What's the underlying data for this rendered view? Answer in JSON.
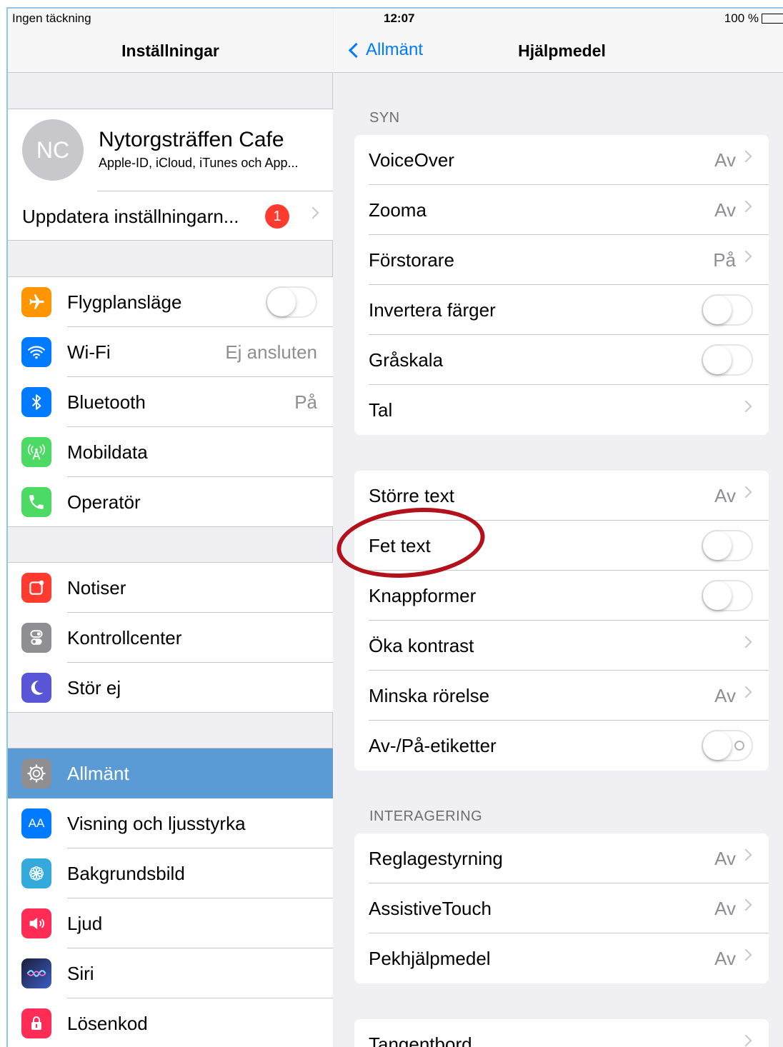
{
  "status": {
    "carrier": "Ingen täckning",
    "time": "12:07",
    "battery": "100 %"
  },
  "left": {
    "title": "Inställningar",
    "profile": {
      "initials": "NC",
      "name": "Nytorgsträffen Cafe",
      "subtitle": "Apple-ID, iCloud, iTunes och App..."
    },
    "update": {
      "label": "Uppdatera inställningarn...",
      "badge": "1"
    },
    "items": [
      {
        "label": "Flygplansläge",
        "value": "",
        "icon": "airplane-icon",
        "color": "#ff9500"
      },
      {
        "label": "Wi-Fi",
        "value": "Ej ansluten",
        "icon": "wifi-icon",
        "color": "#007aff"
      },
      {
        "label": "Bluetooth",
        "value": "På",
        "icon": "bluetooth-icon",
        "color": "#007aff"
      },
      {
        "label": "Mobildata",
        "value": "",
        "icon": "antenna-icon",
        "color": "#4cd964"
      },
      {
        "label": "Operatör",
        "value": "",
        "icon": "phone-icon",
        "color": "#4cd964"
      },
      {
        "label": "Notiser",
        "value": "",
        "icon": "notifications-icon",
        "color": "#ff3b30"
      },
      {
        "label": "Kontrollcenter",
        "value": "",
        "icon": "control-center-icon",
        "color": "#8e8e93"
      },
      {
        "label": "Stör ej",
        "value": "",
        "icon": "moon-icon",
        "color": "#5856d6"
      },
      {
        "label": "Allmänt",
        "value": "",
        "icon": "gear-icon",
        "color": "#8e8e93"
      },
      {
        "label": "Visning och ljusstyrka",
        "value": "",
        "icon": "display-icon",
        "color": "#007aff"
      },
      {
        "label": "Bakgrundsbild",
        "value": "",
        "icon": "wallpaper-icon",
        "color": "#34aadc"
      },
      {
        "label": "Ljud",
        "value": "",
        "icon": "speaker-icon",
        "color": "#ff2d55"
      },
      {
        "label": "Siri",
        "value": "",
        "icon": "siri-icon",
        "color": "#1c1c3a"
      },
      {
        "label": "Lösenkod",
        "value": "",
        "icon": "lock-icon",
        "color": "#ff2d55"
      }
    ]
  },
  "right": {
    "back": "Allmänt",
    "title": "Hjälpmedel",
    "syn_header": "SYN",
    "syn": [
      {
        "label": "VoiceOver",
        "value": "Av"
      },
      {
        "label": "Zooma",
        "value": "Av"
      },
      {
        "label": "Förstorare",
        "value": "På"
      },
      {
        "label": "Invertera färger",
        "value": ""
      },
      {
        "label": "Gråskala",
        "value": ""
      },
      {
        "label": "Tal",
        "value": ""
      }
    ],
    "text": [
      {
        "label": "Större text",
        "value": "Av"
      },
      {
        "label": "Fet text",
        "value": ""
      },
      {
        "label": "Knappformer",
        "value": ""
      },
      {
        "label": "Öka kontrast",
        "value": ""
      },
      {
        "label": "Minska rörelse",
        "value": "Av"
      },
      {
        "label": "Av-/På-etiketter",
        "value": ""
      }
    ],
    "interaction_header": "INTERAGERING",
    "interaction": [
      {
        "label": "Reglagestyrning",
        "value": "Av"
      },
      {
        "label": "AssistiveTouch",
        "value": "Av"
      },
      {
        "label": "Pekhjälpmedel",
        "value": "Av"
      }
    ],
    "keyboard": {
      "label": "Tangentbord"
    }
  },
  "colors": {
    "accent": "#007aff",
    "selected": "#5b9bd5",
    "annotation": "#b3111c"
  }
}
